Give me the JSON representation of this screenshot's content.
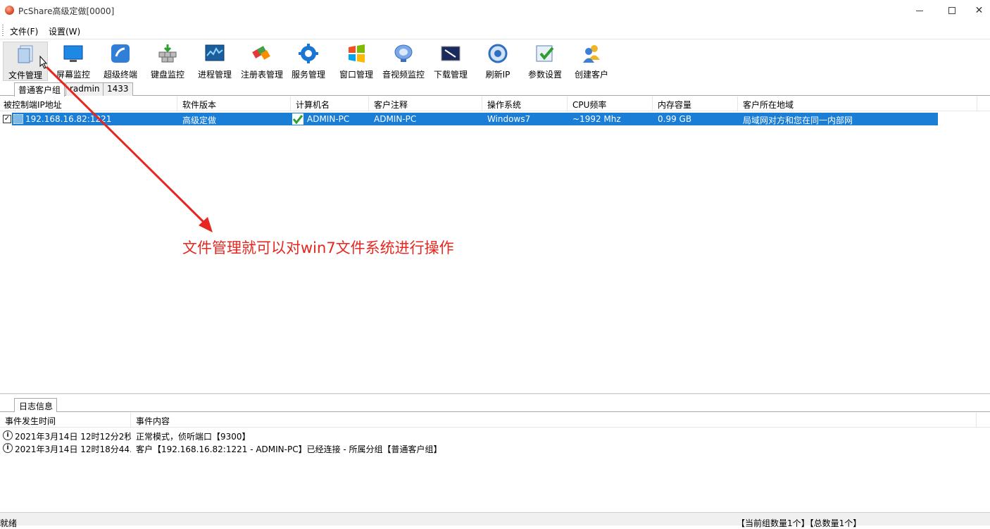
{
  "window": {
    "title": "PcShare高级定做[0000]"
  },
  "menu": {
    "file": "文件(F)",
    "settings": "设置(W)"
  },
  "toolbar": [
    {
      "label": "文件管理",
      "icon": "file-manager-icon"
    },
    {
      "label": "屏幕监控",
      "icon": "screen-monitor-icon"
    },
    {
      "label": "超级终端",
      "icon": "terminal-icon"
    },
    {
      "label": "键盘监控",
      "icon": "keyboard-monitor-icon"
    },
    {
      "label": "进程管理",
      "icon": "process-manager-icon"
    },
    {
      "label": "注册表管理",
      "icon": "registry-icon"
    },
    {
      "label": "服务管理",
      "icon": "service-gear-icon"
    },
    {
      "label": "窗口管理",
      "icon": "windows-logo-icon"
    },
    {
      "label": "音视频监控",
      "icon": "webcam-icon"
    },
    {
      "label": "下载管理",
      "icon": "download-icon"
    },
    {
      "label": "刷新IP",
      "icon": "refresh-icon"
    },
    {
      "label": "参数设置",
      "icon": "settings-check-icon"
    },
    {
      "label": "创建客户",
      "icon": "users-icon"
    }
  ],
  "group_tabs": [
    "普通客户组",
    "radmin",
    "1433"
  ],
  "columns": [
    "被控制端IP地址",
    "软件版本",
    "计算机名",
    "客户注释",
    "操作系统",
    "CPU频率",
    "内存容量",
    "客户所在地域"
  ],
  "clients": [
    {
      "checked": "✓",
      "ip": "192.168.16.82:1221",
      "version": "高级定做",
      "computer": "ADMIN-PC",
      "note": "ADMIN-PC",
      "os": "Windows7",
      "cpu": "~1992 Mhz",
      "memory": "0.99 GB",
      "region": "局域网对方和您在同一内部网"
    }
  ],
  "annotation": {
    "text": "文件管理就可以对win7文件系统进行操作",
    "color": "#e6261f"
  },
  "log": {
    "tab": "日志信息",
    "columns": [
      "事件发生时间",
      "事件内容"
    ],
    "rows": [
      {
        "time": "2021年3月14日 12时12分2秒",
        "msg": "正常模式，侦听端口【9300】"
      },
      {
        "time": "2021年3月14日 12时18分44...",
        "msg": "客户【192.168.16.82:1221 - ADMIN-PC】已经连接 - 所属分组【普通客户组】"
      }
    ]
  },
  "status": {
    "left": "就绪",
    "right": "【当前组数量1个】【总数量1个】"
  },
  "colors": {
    "selection": "#1a7ed6",
    "annotation": "#e6261f"
  }
}
